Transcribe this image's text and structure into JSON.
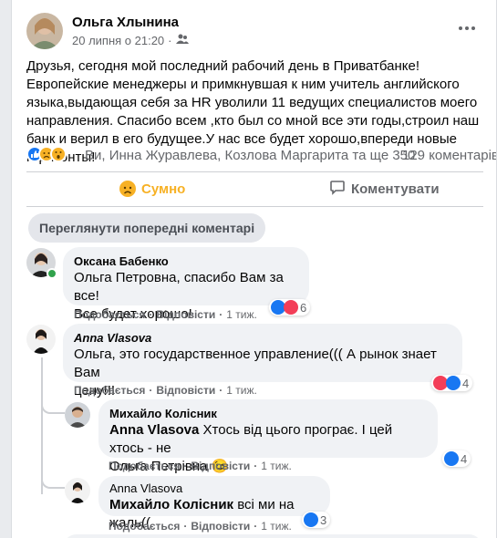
{
  "post": {
    "author": "Ольга Хлынина",
    "date": "20 липня о 21:20",
    "text": "Друзья, сегодня мой последний рабочий день в Приватбанке!Европейские менеджеры и примкнувшая к ним учитель английского языка,выдающая себя за HR уволили 11 ведущих специалистов моего направления. Спасибо всем ,кто был со мной все эти годы,строил наш банк и верил в его будущее.У нас все будет хорошо,впереди новые горизонты!",
    "reactions_text": "Ви, Инна Журавлева, Козлова Маргарита та ще 350",
    "comments_count": "129 коментарів"
  },
  "actions": {
    "sad_label": "Сумно",
    "comment_label": "Коментувати"
  },
  "prev_comments_label": "Переглянути попередні коментарі",
  "comment_actions": {
    "like": "Подобається",
    "reply": "Відповісти",
    "dot": "·"
  },
  "comments": [
    {
      "name": "Оксана Бабенко",
      "line1": "Ольга Петровна, спасибо Вам за все!",
      "line2": "Все будет хорошо!",
      "time": "1 тиж.",
      "reactions": "6"
    },
    {
      "name": "Anna Vlasova",
      "line1": "Ольга, это государственное управление((( А рынок знает Вам",
      "line2": "цену!!!",
      "time": "1 тиж.",
      "reactions": "4"
    }
  ],
  "replies": [
    {
      "name": "Михайло Колісник",
      "mention": "Anna Vlasova",
      "line1": "Хтось від цього програє. І цей хтось - не",
      "line2": "Ольга Петрівна 😉",
      "time": "1 тиж.",
      "reactions": "4"
    },
    {
      "name": "Anna Vlasova",
      "mention": "Михайло Колісник",
      "line1": "всі ми на жаль((",
      "time": "1 тиж.",
      "reactions": "3"
    }
  ],
  "icons": {
    "privacy": "friends-icon",
    "more": "more-icon",
    "sad": "sad-emoji",
    "like": "like-icon",
    "love": "love-icon",
    "comment": "comment-icon"
  },
  "colors": {
    "like": "#1877f2",
    "love": "#f33e58",
    "sad": "#f7b125",
    "online": "#31a24c"
  }
}
